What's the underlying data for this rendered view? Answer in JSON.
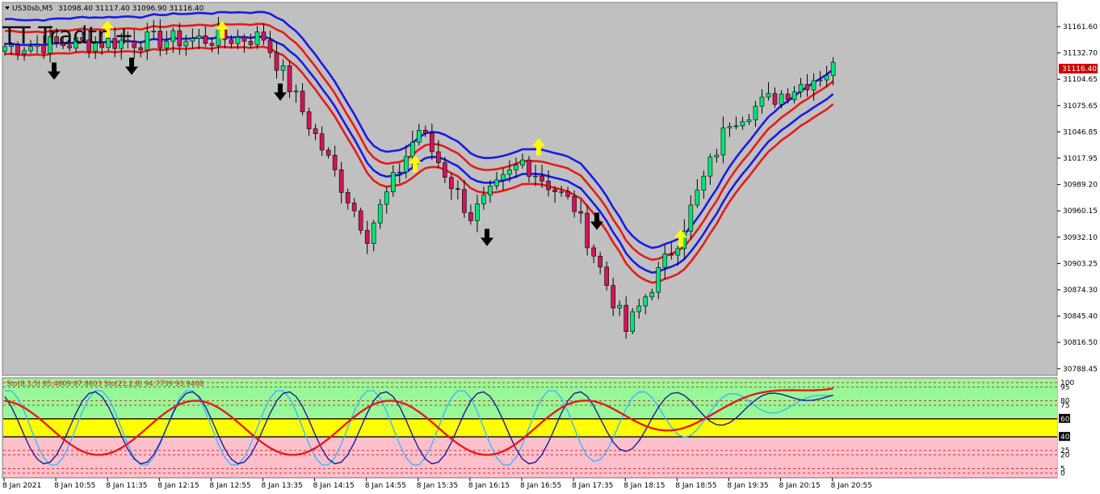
{
  "header": {
    "symbol": "US30sb,M5",
    "ohlc": "31098.40 31117.40 31096.90 31116.40"
  },
  "watermark": "TT Tradtr +",
  "price_axis": {
    "labels": [
      "31161.60",
      "31132.70",
      "31104.65",
      "31075.65",
      "31046.85",
      "31017.95",
      "30989.20",
      "30960.15",
      "30932.10",
      "30903.25",
      "30874.30",
      "30845.40",
      "30816.50",
      "30788.45"
    ],
    "current_price": "31116.40"
  },
  "time_axis": {
    "labels": [
      "8 Jan 2021",
      "8 Jan 10:55",
      "8 Jan 11:35",
      "8 Jan 12:15",
      "8 Jan 12:55",
      "8 Jan 13:35",
      "8 Jan 14:15",
      "8 Jan 14:55",
      "8 Jan 15:35",
      "8 Jan 16:15",
      "8 Jan 16:55",
      "8 Jan 17:35",
      "8 Jan 18:15",
      "8 Jan 18:55",
      "8 Jan 19:35",
      "8 Jan 20:15",
      "8 Jan 20:55"
    ]
  },
  "oscillator": {
    "label": "Sto(8,3,5) 85.4809 87.8603  Sto(21,2,8) 94.7739 93.9468",
    "levels": [
      "100",
      "95",
      "80",
      "75",
      "60",
      "40",
      "25",
      "20",
      "5",
      "0"
    ]
  },
  "colors": {
    "background": "#c0c0c0",
    "bull_candle": "#00e676",
    "bear_candle": "#d4145a",
    "band_blue": "#1a1ae6",
    "band_red": "#e61a1a",
    "zone_green": "#98f898",
    "zone_yellow": "#ffff00",
    "zone_pink": "#ffc0cb",
    "sto_fast": "#3ab6ff",
    "sto_fast_signal": "#1a1aa0",
    "sto_slow": "#e61a1a"
  },
  "chart_data": [
    {
      "type": "candlestick",
      "title": "US30sb,M5",
      "x_start": "8 Jan 2021",
      "x_end": "8 Jan 20:55",
      "ylim": [
        30788.45,
        31161.6
      ],
      "key_points": [
        {
          "time": "8 Jan 2021",
          "price": 31140
        },
        {
          "time": "8 Jan 11:35",
          "price": 31145
        },
        {
          "time": "8 Jan 13:35",
          "price": 31150
        },
        {
          "time": "8 Jan 14:55",
          "price": 30935
        },
        {
          "time": "8 Jan 15:35",
          "price": 31050
        },
        {
          "time": "8 Jan 16:15",
          "price": 30955
        },
        {
          "time": "8 Jan 16:55",
          "price": 31015
        },
        {
          "time": "8 Jan 17:35",
          "price": 30965
        },
        {
          "time": "8 Jan 18:15",
          "price": 30830
        },
        {
          "time": "8 Jan 18:55",
          "price": 30930
        },
        {
          "time": "8 Jan 19:35",
          "price": 31060
        },
        {
          "time": "8 Jan 20:55",
          "price": 31116.4
        }
      ],
      "arrows_up_count": 5,
      "arrows_down_count": 5
    },
    {
      "type": "line",
      "title": "Sto(8,3,5) / Sto(21,2,8)",
      "ylim": [
        0,
        100
      ],
      "series": [
        {
          "name": "Sto(8,3,5)",
          "last_values": [
            85.4809,
            87.8603
          ]
        },
        {
          "name": "Sto(21,2,8)",
          "last_values": [
            94.7739,
            93.9468
          ]
        }
      ]
    }
  ]
}
